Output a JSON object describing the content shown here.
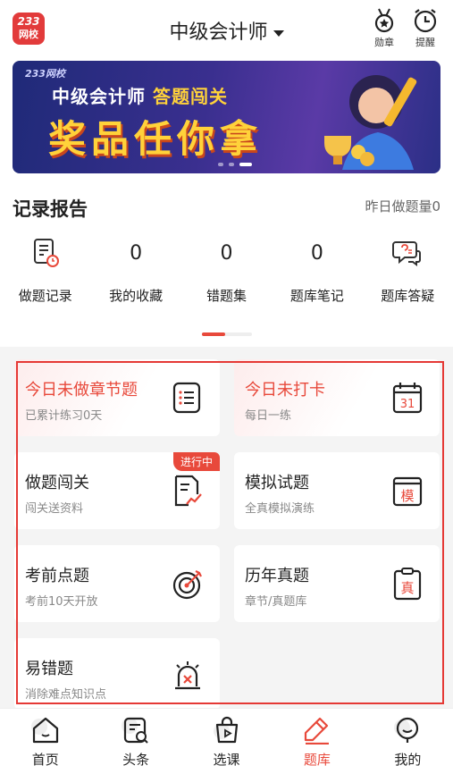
{
  "header": {
    "logo_number": "233",
    "logo_text": "网校",
    "title": "中级会计师",
    "medal_label": "勋章",
    "reminder_label": "提醒"
  },
  "banner": {
    "brand": "233网校",
    "line1_prefix": "中级会计师",
    "line1_highlight": "答题闯关",
    "line2": "奖品任你拿"
  },
  "record": {
    "title": "记录报告",
    "yesterday": "昨日做题量0",
    "stats": [
      {
        "label": "做题记录",
        "icon": "exercise-record-icon"
      },
      {
        "label": "我的收藏",
        "value": "0"
      },
      {
        "label": "错题集",
        "value": "0"
      },
      {
        "label": "题库笔记",
        "value": "0"
      },
      {
        "label": "题库答疑",
        "icon": "question-chat-icon"
      }
    ]
  },
  "cards": [
    {
      "title": "今日未做章节题",
      "sub": "已累计练习0天",
      "icon": "list-doc-icon"
    },
    {
      "title": "今日未打卡",
      "sub": "每日一练",
      "icon": "calendar-icon",
      "icon_text": "31"
    },
    {
      "title": "做题闯关",
      "sub": "闯关送资料",
      "icon": "chart-doc-icon",
      "badge": "进行中"
    },
    {
      "title": "模拟试题",
      "sub": "全真模拟演练",
      "icon": "mock-paper-icon",
      "icon_text": "模"
    },
    {
      "title": "考前点题",
      "sub": "考前10天开放",
      "icon": "target-icon"
    },
    {
      "title": "历年真题",
      "sub": "章节/真题库",
      "icon": "clipboard-icon",
      "icon_text": "真"
    },
    {
      "title": "易错题",
      "sub": "消除难点知识点",
      "icon": "alarm-icon"
    }
  ],
  "tabs": [
    {
      "label": "首页",
      "icon": "home-icon"
    },
    {
      "label": "头条",
      "icon": "news-icon"
    },
    {
      "label": "选课",
      "icon": "course-bag-icon"
    },
    {
      "label": "题库",
      "icon": "pen-icon",
      "active": true
    },
    {
      "label": "我的",
      "icon": "profile-icon"
    }
  ],
  "colors": {
    "accent": "#e8493b",
    "banner_bg": "#2b2f86",
    "highlight": "#ffd23a"
  }
}
